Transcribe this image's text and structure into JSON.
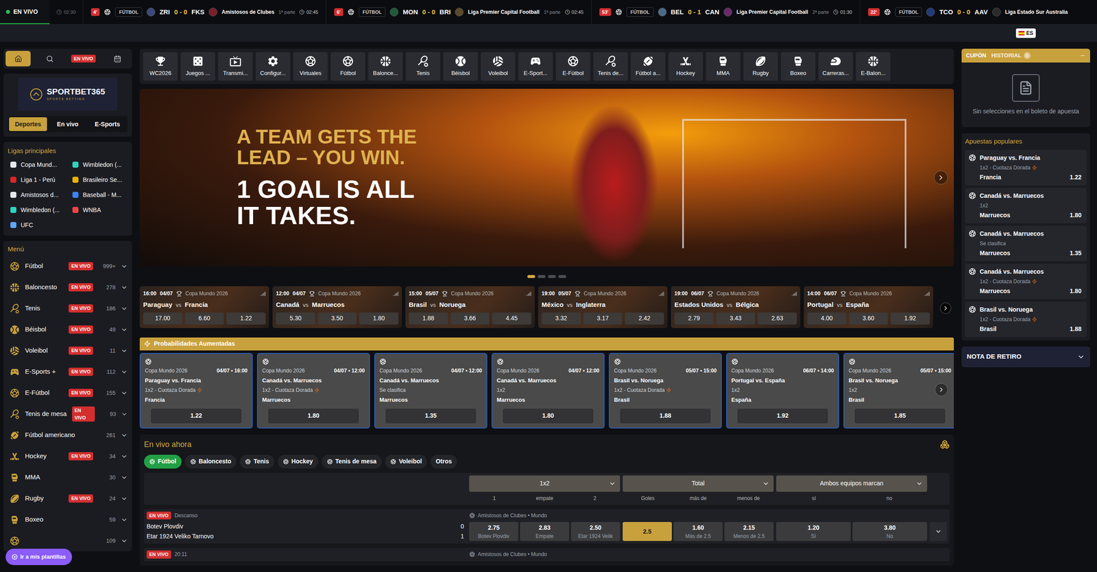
{
  "ticker": {
    "live_label": "EN VIVO",
    "first_time": "02:30",
    "items": [
      {
        "minute": "4'",
        "sport": "FÚTBOL",
        "home": "ZRI",
        "score": "0 - 0",
        "away": "FKS",
        "league": "Amistosos de Clubes",
        "period": "1ª parte",
        "time": "02:45"
      },
      {
        "minute": "6'",
        "sport": "FÚTBOL",
        "home": "MON",
        "score": "0 - 0",
        "away": "BRI",
        "league": "Liga Premier Capital Football",
        "period": "1ª parte",
        "time": "02:45"
      },
      {
        "minute": "53'",
        "sport": "FÚTBOL",
        "home": "BEL",
        "score": "0 - 1",
        "away": "CAN",
        "league": "Liga Premier Capital Football",
        "period": "2ª parte",
        "time": "01:30"
      },
      {
        "minute": "22'",
        "sport": "FÚTBOL",
        "home": "TCO",
        "score": "0 - 0",
        "away": "AAV",
        "league": "Liga Estado Sur Australia"
      }
    ]
  },
  "language": "ES",
  "sidebar": {
    "quick_nav": [
      {
        "kind": "home",
        "selected": true
      },
      {
        "kind": "search",
        "selected": false
      },
      {
        "kind": "live",
        "label": "EN VIVO",
        "selected": false
      },
      {
        "kind": "calendar",
        "selected": false
      }
    ],
    "logo": {
      "name": "SPORTBET365",
      "tagline": "SPORTS BETTING"
    },
    "tabs": [
      {
        "label": "Deportes",
        "selected": true
      },
      {
        "label": "En vivo",
        "selected": false
      },
      {
        "label": "E-Sports",
        "selected": false
      }
    ],
    "leagues_title": "Ligas principales",
    "leagues": [
      {
        "label": "Copa Mund..."
      },
      {
        "label": "Wimbledon (..."
      },
      {
        "label": "Liga 1 - Perú"
      },
      {
        "label": "Brasileiro Se..."
      },
      {
        "label": "Amistosos d..."
      },
      {
        "label": "Baseball - M..."
      },
      {
        "label": "Wimbledon (..."
      },
      {
        "label": "WNBA"
      },
      {
        "label": "UFC"
      }
    ],
    "menu_title": "Menú",
    "menu": [
      {
        "label": "Fútbol",
        "live": true,
        "count": "999+"
      },
      {
        "label": "Baloncesto",
        "live": true,
        "count": "278"
      },
      {
        "label": "Tenis",
        "live": true,
        "count": "186"
      },
      {
        "label": "Béisbol",
        "live": true,
        "count": "49"
      },
      {
        "label": "Voleibol",
        "live": true,
        "count": "11"
      },
      {
        "label": "E-Sports +",
        "live": true,
        "count": "112"
      },
      {
        "label": "E-Fútbol",
        "live": true,
        "count": "155"
      },
      {
        "label": "Tenis de mesa",
        "live": true,
        "count": "93"
      },
      {
        "label": "Fútbol americano",
        "live": false,
        "count": "261"
      },
      {
        "label": "Hockey",
        "live": true,
        "count": "34"
      },
      {
        "label": "MMA",
        "live": false,
        "count": "30"
      },
      {
        "label": "Rugby",
        "live": true,
        "count": "24"
      },
      {
        "label": "Boxeo",
        "live": false,
        "count": "59"
      },
      {
        "label": "",
        "live": false,
        "count": "109"
      }
    ],
    "live_badge": "EN VIVO",
    "templates_button": "Ir a mis plantillas"
  },
  "sports_nav": [
    "WC2026",
    "Juegos ...",
    "Transmi...",
    "Configur...",
    "Virtuales",
    "Fútbol",
    "Balonce...",
    "Tenis",
    "Béisbol",
    "Voleibol",
    "E-Sport...",
    "E-Fútbol",
    "Tenis de...",
    "Fútbol a...",
    "Hockey",
    "MMA",
    "Rugby",
    "Boxeo",
    "Carreras...",
    "E-Balon..."
  ],
  "banner": {
    "lines_gold": [
      "A TEAM GETS THE",
      "LEAD – YOU WIN."
    ],
    "lines_white": [
      "1 GOAL IS ALL",
      "IT TAKES."
    ],
    "slides": [
      {
        "selected": true
      },
      {
        "selected": false
      },
      {
        "selected": false
      },
      {
        "selected": false
      }
    ]
  },
  "vs_label": "vs",
  "featured_matches": [
    {
      "time": "16:00",
      "date": "04/07",
      "league": "Copa Mundo 2026",
      "home": "Paraguay",
      "away": "Francia",
      "odds": [
        "17.00",
        "6.60",
        "1.22"
      ]
    },
    {
      "time": "12:00",
      "date": "04/07",
      "league": "Copa Mundo 2026",
      "home": "Canadá",
      "away": "Marruecos",
      "odds": [
        "5.30",
        "3.50",
        "1.80"
      ]
    },
    {
      "time": "15:00",
      "date": "05/07",
      "league": "Copa Mundo 2026",
      "home": "Brasil",
      "away": "Noruega",
      "odds": [
        "1.88",
        "3.66",
        "4.45"
      ]
    },
    {
      "time": "19:00",
      "date": "05/07",
      "league": "Copa Mundo 2026",
      "home": "México",
      "away": "Inglaterra",
      "odds": [
        "3.32",
        "3.17",
        "2.42"
      ]
    },
    {
      "time": "19:00",
      "date": "06/07",
      "league": "Copa Mundo 2026",
      "home": "Estados Unidos",
      "away": "Bélgica",
      "odds": [
        "2.79",
        "3.43",
        "2.63"
      ]
    },
    {
      "time": "14:00",
      "date": "06/07",
      "league": "Copa Mundo 2026",
      "home": "Portugal",
      "away": "España",
      "odds": [
        "4.00",
        "3.60",
        "1.92"
      ]
    }
  ],
  "boosted": {
    "title": "Probabilidades Aumentadas",
    "cards": [
      {
        "league": "Copa Mundo 2026",
        "datetime": "04/07 • 16:00",
        "match": "Paraguay vs. Francia",
        "market": "1x2 - Cuotaza Dorada",
        "golden": true,
        "pick": "Francia",
        "odd": "1.22"
      },
      {
        "league": "Copa Mundo 2026",
        "datetime": "04/07 • 12:00",
        "match": "Canadá vs. Marruecos",
        "market": "1x2 - Cuotaza Dorada",
        "golden": true,
        "pick": "Marruecos",
        "odd": "1.80"
      },
      {
        "league": "Copa Mundo 2026",
        "datetime": "04/07 • 12:00",
        "match": "Canadá vs. Marruecos",
        "market": "Se clasifica",
        "golden": false,
        "pick": "Marruecos",
        "odd": "1.35"
      },
      {
        "league": "Copa Mundo 2026",
        "datetime": "04/07 • 12:00",
        "match": "Canadá vs. Marruecos",
        "market": "1x2",
        "golden": false,
        "pick": "Marruecos",
        "odd": "1.80"
      },
      {
        "league": "Copa Mundo 2026",
        "datetime": "05/07 • 15:00",
        "match": "Brasil vs. Noruega",
        "market": "1x2 - Cuotaza Dorada",
        "golden": true,
        "pick": "Brasil",
        "odd": "1.88"
      },
      {
        "league": "Copa Mundo 2026",
        "datetime": "06/07 • 14:00",
        "match": "Portugal vs. España",
        "market": "1x2",
        "golden": false,
        "pick": "España",
        "odd": "1.92"
      },
      {
        "league": "Copa Mundo 2026",
        "datetime": "05/07 • 15:00",
        "match": "Brasil vs. Noruega",
        "market": "1x2",
        "golden": false,
        "pick": "Brasil",
        "odd": "1.85"
      }
    ]
  },
  "live": {
    "title": "En vivo ahora",
    "tabs": [
      {
        "label": "Fútbol",
        "selected": true
      },
      {
        "label": "Baloncesto",
        "selected": false
      },
      {
        "label": "Tenis",
        "selected": false
      },
      {
        "label": "Hockey",
        "selected": false
      },
      {
        "label": "Tenis de mesa",
        "selected": false
      },
      {
        "label": "Voleibol",
        "selected": false
      },
      {
        "label": "Otros",
        "selected": false
      }
    ],
    "markets": [
      {
        "label": "1x2",
        "columns": [
          "1",
          "empate",
          "2"
        ]
      },
      {
        "label": "Total",
        "columns": [
          "Goles",
          "más de",
          "menos de"
        ]
      },
      {
        "label": "Ambos equipos marcan",
        "columns": [
          "sí",
          "no"
        ]
      }
    ],
    "matches": [
      {
        "badge": "EN VIVO",
        "status": "Descanso",
        "league": "Amistosos de Clubes • Mundo",
        "home": "Botev Plovdiv",
        "home_score": "0",
        "away": "Etar 1924 Veliko Tarnovo",
        "away_score": "1",
        "selections": [
          [
            {
              "value": "2.75",
              "label": "Botev Plovdiv",
              "selected": false
            },
            {
              "value": "2.83",
              "label": "Empate",
              "selected": false
            },
            {
              "value": "2.50",
              "label": "Etar 1924 Velik",
              "selected": false
            }
          ],
          [
            {
              "value": "2.5",
              "label": "",
              "selected": true
            },
            {
              "value": "1.60",
              "label": "Más de 2.5",
              "selected": false
            },
            {
              "value": "2.15",
              "label": "Menos de 2.5",
              "selected": false
            }
          ],
          [
            {
              "value": "1.20",
              "label": "Sí",
              "selected": false
            },
            {
              "value": "3.80",
              "label": "No",
              "selected": false
            }
          ]
        ]
      },
      {
        "badge": "EN VIVO",
        "status": "20:11",
        "league": "Amistosos de Clubes • Mundo"
      }
    ]
  },
  "coupon": {
    "tabs": [
      {
        "label": "CUPÓN",
        "selected": true
      },
      {
        "label": "HISTORIAL",
        "selected": false,
        "badge": "0"
      }
    ],
    "empty_text": "Sin selecciones en el boleto de apuesta"
  },
  "popular": {
    "title": "Apuestas populares",
    "items": [
      {
        "match": "Paraguay vs. Francia",
        "market": "1x2 - Cuotaza Dorada",
        "golden": true,
        "pick": "Francia",
        "odd": "1.22"
      },
      {
        "match": "Canadá vs. Marruecos",
        "market": "1x2",
        "golden": false,
        "pick": "Marruecos",
        "odd": "1.80"
      },
      {
        "match": "Canadá vs. Marruecos",
        "market": "Se clasifica",
        "golden": false,
        "pick": "Marruecos",
        "odd": "1.35"
      },
      {
        "match": "Canadá vs. Marruecos",
        "market": "1x2 - Cuotaza Dorada",
        "golden": true,
        "pick": "Marruecos",
        "odd": "1.80"
      },
      {
        "match": "Brasil vs. Noruega",
        "market": "1x2 - Cuotaza Dorada",
        "golden": true,
        "pick": "Brasil",
        "odd": "1.88"
      }
    ]
  },
  "withdrawal": {
    "label": "NOTA DE RETIRO",
    "expanded": false
  }
}
